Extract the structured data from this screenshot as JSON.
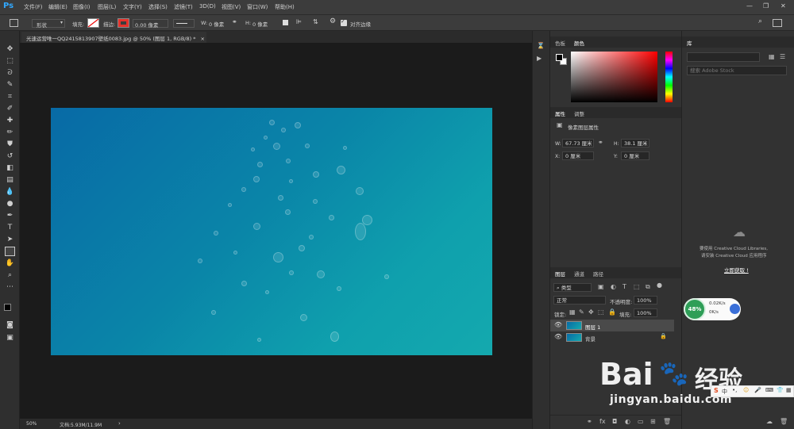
{
  "app": {
    "logo": "Ps"
  },
  "menu": [
    "文件(F)",
    "编辑(E)",
    "图像(I)",
    "图层(L)",
    "文字(Y)",
    "选择(S)",
    "滤镜(T)",
    "3D(D)",
    "视图(V)",
    "窗口(W)",
    "帮助(H)"
  ],
  "window_controls": {
    "minimize": "—",
    "restore": "❐",
    "close": "✕"
  },
  "options": {
    "mode": "形状",
    "fill_label": "填充:",
    "stroke_label": "描边:",
    "stroke_size": "0.00 像素",
    "w_label": "W:",
    "w_value": "0 像素",
    "h_label": "H:",
    "h_value": "0 像素",
    "align_edges": "对齐边缘"
  },
  "document": {
    "tab_title": "光速运营唯一QQ2415813907壁纸0083.jpg @ 50% (图层 1, RGB/8) *",
    "tab_close": "×",
    "zoom": "50%",
    "doc_info": "文档:5.93M/11.9M"
  },
  "color_panel": {
    "tabs": [
      "色板",
      "颜色"
    ],
    "active_tab": "颜色"
  },
  "properties_panel": {
    "tabs": [
      "属性",
      "调整"
    ],
    "title": "像素图层属性",
    "w_label": "W:",
    "w_value": "67.73 厘米",
    "h_label": "H:",
    "h_value": "38.1 厘米",
    "x_label": "X:",
    "x_value": "0 厘米",
    "y_label": "Y:",
    "y_value": "0 厘米"
  },
  "layers_panel": {
    "tabs": [
      "图层",
      "通道",
      "路径"
    ],
    "filter": "类型",
    "blend_mode": "正常",
    "opacity_label": "不透明度:",
    "opacity": "100%",
    "lock_label": "锁定:",
    "fill_label": "填充:",
    "fill": "100%",
    "layers": [
      {
        "name": "图层 1",
        "selected": true
      },
      {
        "name": "背景",
        "locked": true
      }
    ]
  },
  "library_panel": {
    "tab": "库",
    "search_placeholder": "搜索 Adobe Stock",
    "message_line1": "要使用 Creative Cloud Libraries,",
    "message_line2": "请安装 Creative Cloud 应用程序",
    "login": "立即获取 !"
  },
  "net_widget": {
    "percent": "48%",
    "up": "0.02K/s",
    "down": "0K/s"
  },
  "watermark": {
    "brand": "Bai",
    "brand2": "经验",
    "url": "jingyan.baidu.com"
  },
  "ime_tray": {
    "label": "中"
  }
}
